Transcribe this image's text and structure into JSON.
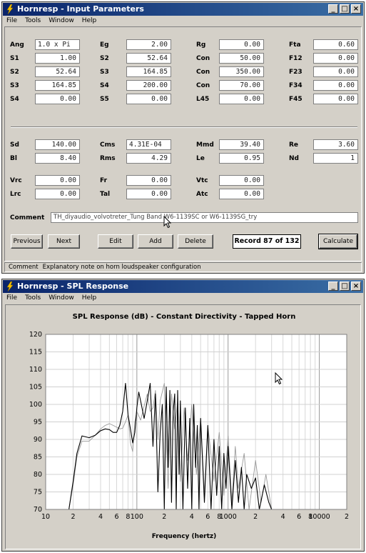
{
  "window1": {
    "title": "Hornresp - Input Parameters",
    "menu": [
      "File",
      "Tools",
      "Window",
      "Help"
    ],
    "params": [
      {
        "label": "Ang",
        "value": "1.0 x Pi"
      },
      {
        "label": "Eg",
        "value": "2.00"
      },
      {
        "label": "Rg",
        "value": "0.00"
      },
      {
        "label": "Fta",
        "value": "0.60"
      },
      {
        "label": "S1",
        "value": "1.00"
      },
      {
        "label": "S2",
        "value": "52.64"
      },
      {
        "label": "Con",
        "value": "50.00"
      },
      {
        "label": "F12",
        "value": "0.00"
      },
      {
        "label": "S2",
        "value": "52.64"
      },
      {
        "label": "S3",
        "value": "164.85"
      },
      {
        "label": "Con",
        "value": "350.00"
      },
      {
        "label": "F23",
        "value": "0.00"
      },
      {
        "label": "S3",
        "value": "164.85"
      },
      {
        "label": "S4",
        "value": "200.00"
      },
      {
        "label": "Con",
        "value": "70.00"
      },
      {
        "label": "F34",
        "value": "0.00"
      },
      {
        "label": "S4",
        "value": "0.00"
      },
      {
        "label": "S5",
        "value": "0.00"
      },
      {
        "label": "L45",
        "value": "0.00"
      },
      {
        "label": "F45",
        "value": "0.00"
      },
      {
        "label": "Sd",
        "value": "140.00"
      },
      {
        "label": "Cms",
        "value": "4.31E-04"
      },
      {
        "label": "Mmd",
        "value": "39.40"
      },
      {
        "label": "Re",
        "value": "3.60"
      },
      {
        "label": "Bl",
        "value": "8.40"
      },
      {
        "label": "Rms",
        "value": "4.29"
      },
      {
        "label": "Le",
        "value": "0.95"
      },
      {
        "label": "Nd",
        "value": "1"
      },
      {
        "label": "Vrc",
        "value": "0.00"
      },
      {
        "label": "Fr",
        "value": "0.00"
      },
      {
        "label": "Vtc",
        "value": "0.00"
      },
      {
        "label": "Lrc",
        "value": "0.00"
      },
      {
        "label": "Tal",
        "value": "0.00"
      },
      {
        "label": "Atc",
        "value": "0.00"
      }
    ],
    "comment_label": "Comment",
    "comment_value": "TH_diyaudio_volvotreter_Tung Band W6-1139SC or W6-1139SG_try",
    "buttons": {
      "previous": "Previous",
      "next": "Next",
      "edit": "Edit",
      "add": "Add",
      "delete": "Delete",
      "calculate": "Calculate"
    },
    "record": "Record 87 of 132",
    "status": {
      "label": "Comment",
      "text": "Explanatory note on horn loudspeaker configuration"
    }
  },
  "window2": {
    "title": "Hornresp - SPL Response",
    "menu": [
      "File",
      "Tools",
      "Window",
      "Help"
    ]
  },
  "chart_data": {
    "type": "line",
    "title": "SPL Response (dB) - Constant Directivity - Tapped Horn",
    "xlabel": "Frequency (hertz)",
    "ylabel": "",
    "x_scale": "log",
    "xlim": [
      10,
      20000
    ],
    "ylim": [
      70,
      120
    ],
    "x_tick_labels": [
      "10",
      "2",
      "4",
      "6",
      "8",
      "100",
      "2",
      "4",
      "6",
      "8",
      "1000",
      "2",
      "4",
      "6",
      "8",
      "10000",
      "2"
    ],
    "y_tick_labels": [
      "120",
      "115",
      "110",
      "105",
      "100",
      "95",
      "90",
      "85",
      "80",
      "75",
      "70"
    ],
    "grid": true,
    "series": [
      {
        "color": "#000000",
        "x": [
          18,
          20,
          22,
          25,
          30,
          35,
          40,
          45,
          50,
          55,
          60,
          65,
          70,
          75,
          80,
          85,
          90,
          95,
          100,
          105,
          110,
          120,
          130,
          140,
          150,
          160,
          170,
          180,
          190,
          200,
          210,
          220,
          230,
          240,
          250,
          260,
          270,
          280,
          290,
          300,
          320,
          340,
          360,
          380,
          400,
          420,
          440,
          460,
          480,
          500,
          550,
          600,
          650,
          700,
          750,
          800,
          850,
          900,
          950,
          1000,
          1100,
          1200,
          1300,
          1400,
          1500,
          1600,
          1800,
          2000,
          2200,
          2500,
          2800,
          3000
        ],
        "y": [
          70,
          78,
          86,
          91,
          90.5,
          91.2,
          92.5,
          93,
          92.8,
          92,
          92,
          94,
          98,
          106,
          97,
          93,
          89,
          92,
          99,
          103.5,
          101,
          96,
          101,
          106,
          88,
          103,
          75,
          92,
          100,
          70,
          105,
          82,
          104,
          72,
          98,
          103,
          70,
          104,
          80,
          101,
          70,
          99,
          76,
          96,
          70,
          100,
          82,
          94,
          70,
          96,
          72,
          94,
          70,
          90,
          74,
          88,
          70,
          86,
          76,
          88,
          70,
          84,
          72,
          82,
          70,
          80,
          76,
          79,
          70,
          77,
          72,
          70
        ]
      },
      {
        "color": "#9a9a9a",
        "x": [
          18,
          20,
          22,
          25,
          30,
          35,
          40,
          45,
          50,
          55,
          60,
          65,
          70,
          75,
          80,
          85,
          90,
          95,
          100,
          110,
          120,
          130,
          140,
          150,
          160,
          170,
          180,
          200,
          220,
          240,
          260,
          280,
          300,
          330,
          360,
          400,
          450,
          500,
          550,
          600,
          700,
          800,
          900,
          1000,
          1100,
          1200,
          1300,
          1500,
          1700,
          2000,
          2300,
          2600,
          3000
        ],
        "y": [
          70,
          77,
          85,
          89.5,
          89.5,
          91.2,
          93,
          94,
          94.5,
          94,
          93.5,
          93,
          93.2,
          95,
          97,
          89,
          86.5,
          95,
          98,
          95.5,
          99.5,
          103,
          98,
          99,
          104,
          90,
          101,
          106,
          76,
          103,
          93,
          101,
          78,
          99,
          84,
          100,
          80,
          96,
          75,
          94,
          78,
          92,
          74,
          91,
          72,
          88,
          76,
          86,
          70,
          84,
          72,
          80,
          70
        ]
      }
    ]
  }
}
